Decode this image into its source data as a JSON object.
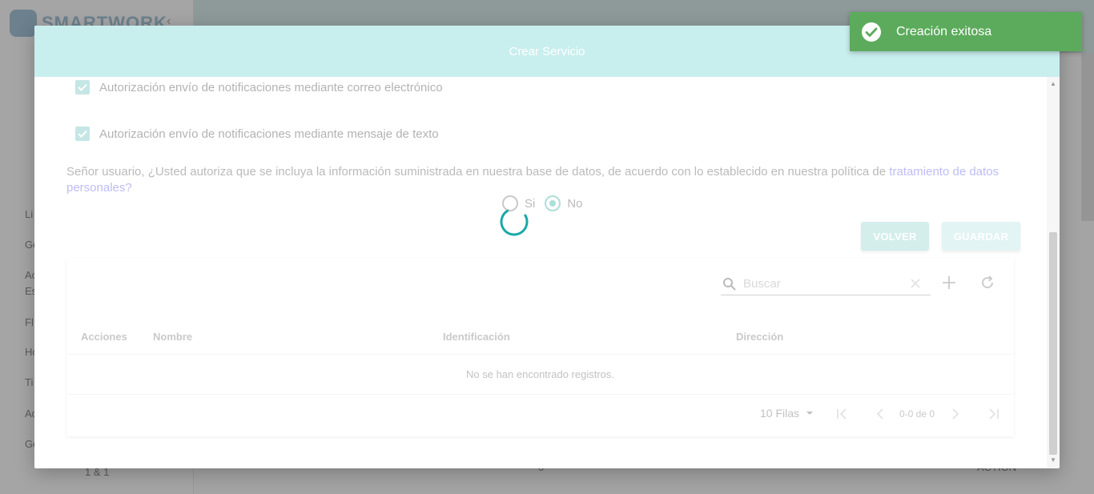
{
  "background": {
    "logo_text": "SMARTWORK",
    "sidebar_items": [
      "Li",
      "Ge",
      "Ac",
      "Es",
      "Fl",
      "Ho",
      "Ti",
      "Ad",
      "Ge"
    ],
    "footer_left": "1 & 1",
    "footer_mid": "0",
    "footer_right": "ACTION"
  },
  "modal": {
    "title": "Crear Servicio",
    "checkbox_email": "Autorización envío de notificaciones mediante correo electrónico",
    "checkbox_sms": "Autorización envío de notificaciones mediante mensaje de texto",
    "consent_text": "Señor usuario, ¿Usted autoriza que se incluya la información suministrada en nuestra base de datos, de acuerdo con lo establecido en nuestra política de ",
    "consent_link": "tratamiento de datos personales?",
    "radio_yes": "Si",
    "radio_no": "No",
    "radio_selected": "No",
    "btn_back": "VOLVER",
    "btn_save": "GUARDAR"
  },
  "table": {
    "search_placeholder": "Buscar",
    "columns": [
      "Acciones",
      "Nombre",
      "Identificación",
      "Dirección"
    ],
    "empty_message": "No se han encontrado registros.",
    "rows_per_page": "10 Filas",
    "range": "0-0 de 0"
  },
  "toast": {
    "message": "Creación exitosa",
    "color": "#5cab5c"
  },
  "colors": {
    "header": "#c9eeee",
    "accent": "#4db6ac",
    "link": "#6a6ae8"
  }
}
